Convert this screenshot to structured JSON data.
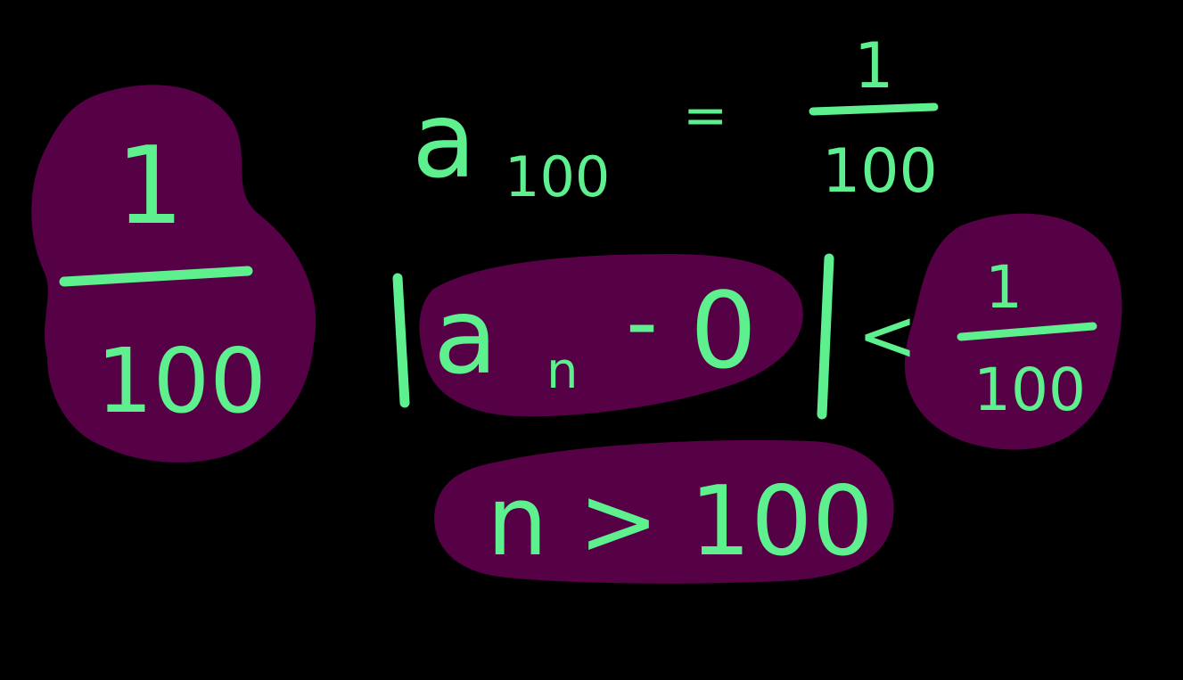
{
  "colors": {
    "background": "#000000",
    "ink": "#5ef08e",
    "highlight": "#560046"
  },
  "equations": {
    "a100_letter": "a",
    "a100_subscript": "100",
    "equals": "=",
    "a100_numerator": "1",
    "a100_denominator": "100",
    "left_numerator": "1",
    "left_denominator": "100",
    "abs_letter": "a",
    "abs_subscript": "n",
    "abs_minus": "-",
    "abs_zero": "0",
    "less_than": "<",
    "right_numerator": "1",
    "right_denominator": "100",
    "condition": "n > 100"
  }
}
